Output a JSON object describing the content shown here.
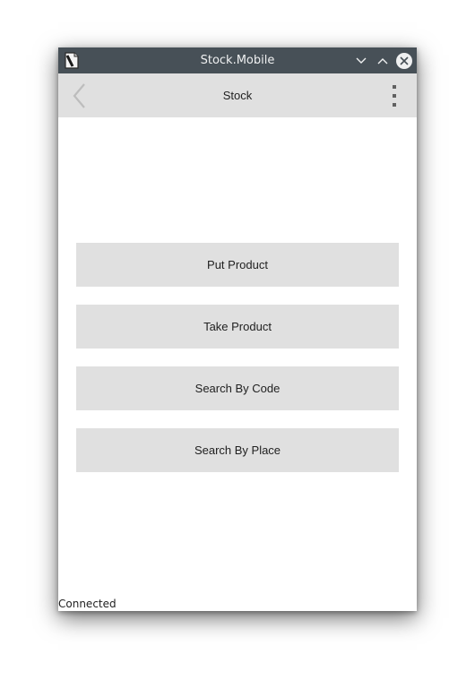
{
  "window": {
    "title": "Stock.Mobile"
  },
  "appbar": {
    "title": "Stock"
  },
  "actions": [
    {
      "label": "Put Product"
    },
    {
      "label": "Take Product"
    },
    {
      "label": "Search By Code"
    },
    {
      "label": "Search By Place"
    }
  ],
  "status": {
    "text": "Connected"
  },
  "icons": {
    "app": "app-document-icon",
    "minimize": "chevron-down-icon",
    "maximize": "chevron-up-icon",
    "close": "close-icon",
    "back": "back-arrow-icon",
    "menu": "more-vert-icon"
  },
  "colors": {
    "titlebar": "#475057",
    "appbar": "#e0e0e0",
    "button": "#e0e0e0",
    "text": "#212121"
  }
}
